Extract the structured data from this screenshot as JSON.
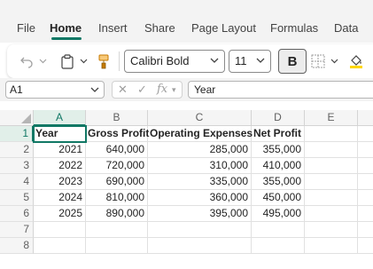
{
  "menu": {
    "tabs": [
      {
        "label": "File"
      },
      {
        "label": "Home"
      },
      {
        "label": "Insert"
      },
      {
        "label": "Share"
      },
      {
        "label": "Page Layout"
      },
      {
        "label": "Formulas"
      },
      {
        "label": "Data"
      }
    ],
    "active": "Home"
  },
  "toolbar": {
    "font_name": "Calibri Bold",
    "font_size": "11",
    "bold_label": "B",
    "icons": [
      "undo-icon",
      "clipboard-icon",
      "format-painter-icon",
      "borders-icon",
      "fill-color-icon"
    ]
  },
  "formula_bar": {
    "name_box": "A1",
    "fx_label": "fx",
    "content": "Year"
  },
  "sheet": {
    "columns": [
      "A",
      "B",
      "C",
      "D",
      "E"
    ],
    "rows": [
      "1",
      "2",
      "3",
      "4",
      "5",
      "6",
      "7",
      "8"
    ],
    "headers": [
      "Year",
      "Gross Profit",
      "Operating Expenses",
      "Net Profit"
    ],
    "data": [
      [
        "2021",
        "640,000",
        "285,000",
        "355,000"
      ],
      [
        "2022",
        "720,000",
        "310,000",
        "410,000"
      ],
      [
        "2023",
        "690,000",
        "335,000",
        "355,000"
      ],
      [
        "2024",
        "810,000",
        "360,000",
        "450,000"
      ],
      [
        "2025",
        "890,000",
        "395,000",
        "495,000"
      ]
    ]
  },
  "colors": {
    "accent": "#117865",
    "header_bg": "#f5f5f5",
    "selected_header_bg": "#e1efe9"
  }
}
